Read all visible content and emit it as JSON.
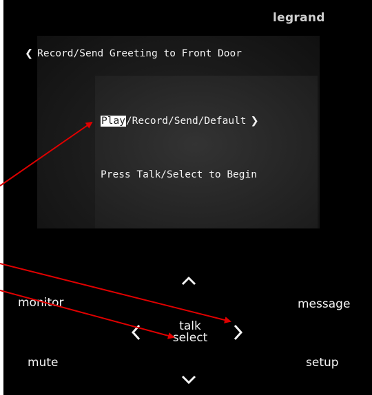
{
  "brand": "legrand",
  "screen": {
    "title": "Record/Send Greeting to Front Door",
    "options_highlighted": "Play",
    "options_rest": "/Record/Send/Default",
    "hint": "Press Talk/Select to Begin"
  },
  "buttons": {
    "monitor": "monitor",
    "message": "message",
    "mute": "mute",
    "setup": "setup",
    "talk": "talk",
    "select": "select"
  },
  "icons": {
    "back": "chevron-left-icon",
    "next_option": "chevron-right-icon",
    "up": "chevron-up-icon",
    "down": "chevron-down-icon",
    "left": "chevron-left-icon",
    "right": "chevron-right-icon"
  },
  "colors": {
    "panel": "#000000",
    "screen": "#1b1b1b",
    "annotation_arrow": "#e00000",
    "highlight": "#ffffff"
  }
}
